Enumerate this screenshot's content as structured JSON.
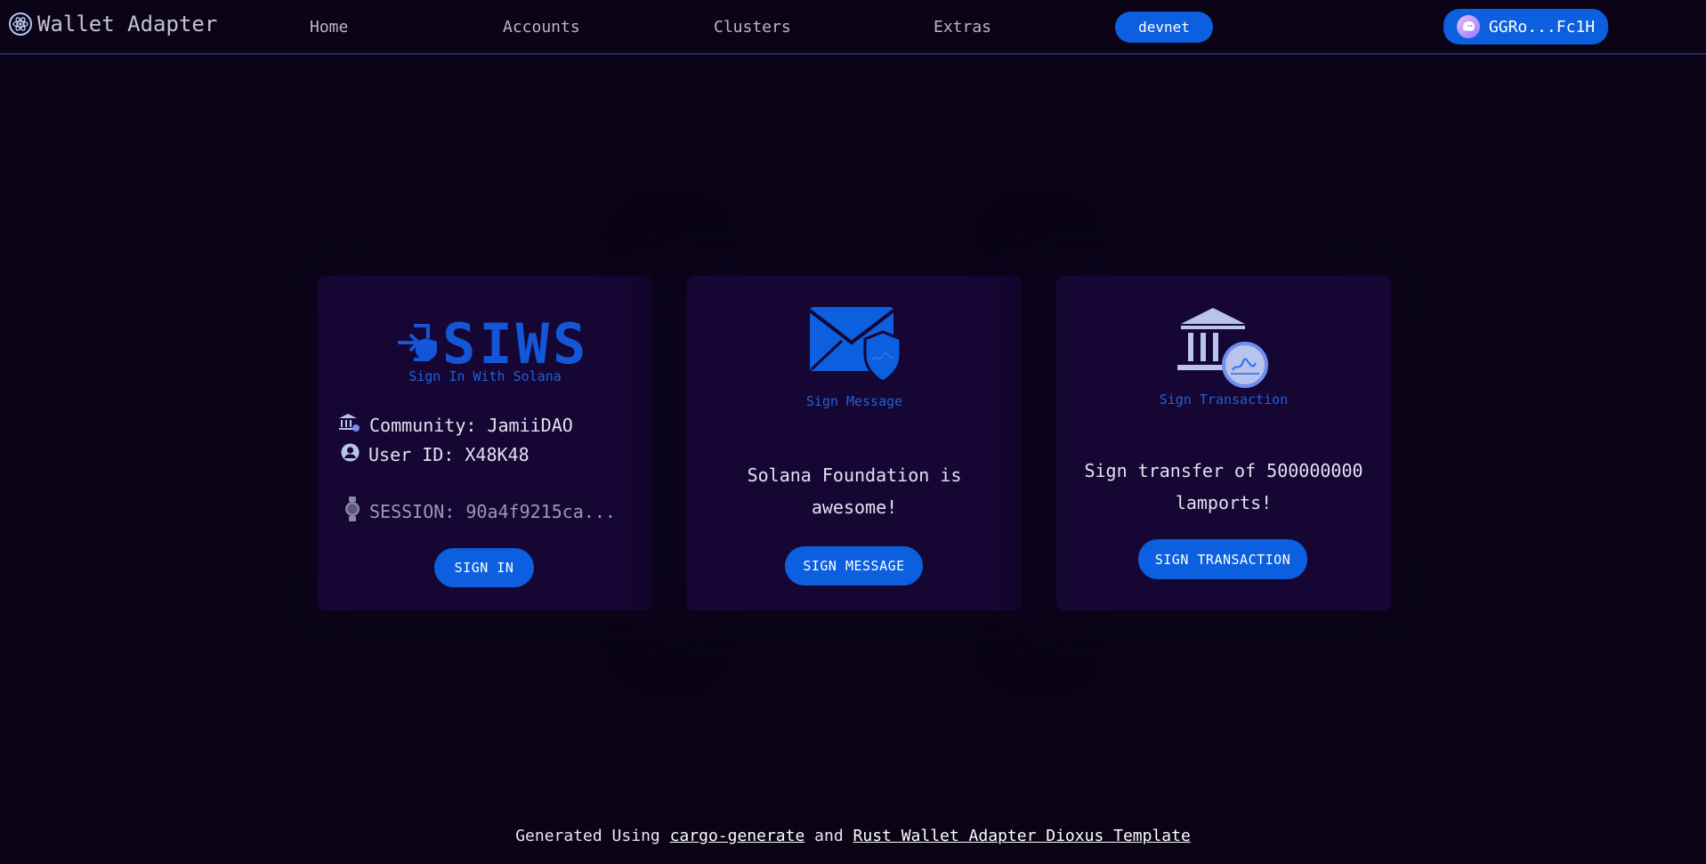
{
  "header": {
    "brand_title": "Wallet Adapter",
    "nav": [
      {
        "label": "Home"
      },
      {
        "label": "Accounts"
      },
      {
        "label": "Clusters"
      },
      {
        "label": "Extras"
      }
    ],
    "cluster_label": "devnet",
    "wallet_address": "GGRo...Fc1H"
  },
  "cards": {
    "siws": {
      "logo_text": "SIWS",
      "label": "Sign In With Solana",
      "community": "Community: JamiiDAO",
      "user_id": "User ID: X48K48",
      "session": "SESSION: 90a4f9215ca...",
      "button_label": "SIGN IN"
    },
    "message": {
      "label": "Sign Message",
      "text": "Solana Foundation is awesome!",
      "button_label": "SIGN MESSAGE"
    },
    "transaction": {
      "label": "Sign Transaction",
      "text": "Sign transfer of 500000000 lamports!",
      "button_label": "SIGN TRANSACTION"
    }
  },
  "footer": {
    "prefix": "Generated Using",
    "link1": "cargo-generate",
    "middle": "and",
    "link2": "Rust Wallet Adapter Dioxus Template"
  },
  "colors": {
    "background": "#0a0416",
    "card": "#160634",
    "accent": "#0c5fde",
    "label": "#1e62dc"
  },
  "icons": [
    "atom-logo-icon",
    "login-shield-icon",
    "bank-icon",
    "user-circle-icon",
    "watch-icon",
    "envelope-shield-icon",
    "bank-signature-icon",
    "wallet-ghost-icon"
  ]
}
